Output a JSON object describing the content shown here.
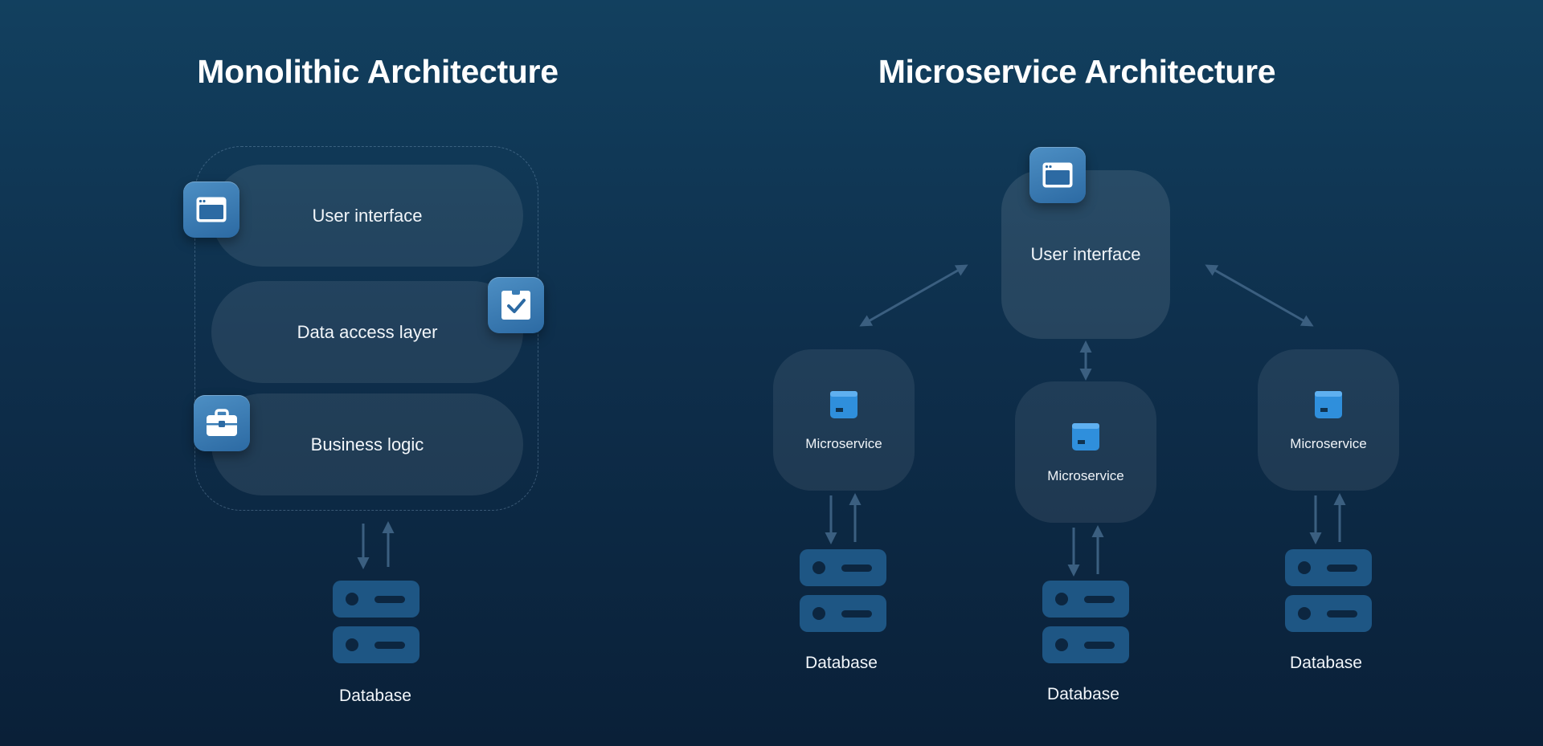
{
  "monolithic": {
    "title": "Monolithic Architecture",
    "layers": {
      "user_interface": "User interface",
      "data_access": "Data access layer",
      "business_logic": "Business logic"
    },
    "database_label": "Database"
  },
  "microservice": {
    "title": "Microservice Architecture",
    "user_interface": "User interface",
    "services": [
      {
        "label": "Microservice",
        "database_label": "Database"
      },
      {
        "label": "Microservice",
        "database_label": "Database"
      },
      {
        "label": "Microservice",
        "database_label": "Database"
      }
    ]
  },
  "colors": {
    "background_top": "#12405f",
    "background_bottom": "#0a2038",
    "icon_tile": "#3a7db6",
    "database": "#1e5684",
    "service_icon": "#2f8fdc",
    "arrow": "#3b5f80"
  },
  "icons": {
    "ui": "browser-window-icon",
    "data_access": "clipboard-check-icon",
    "business_logic": "briefcase-icon",
    "service": "box-icon",
    "database": "server-stack-icon"
  }
}
